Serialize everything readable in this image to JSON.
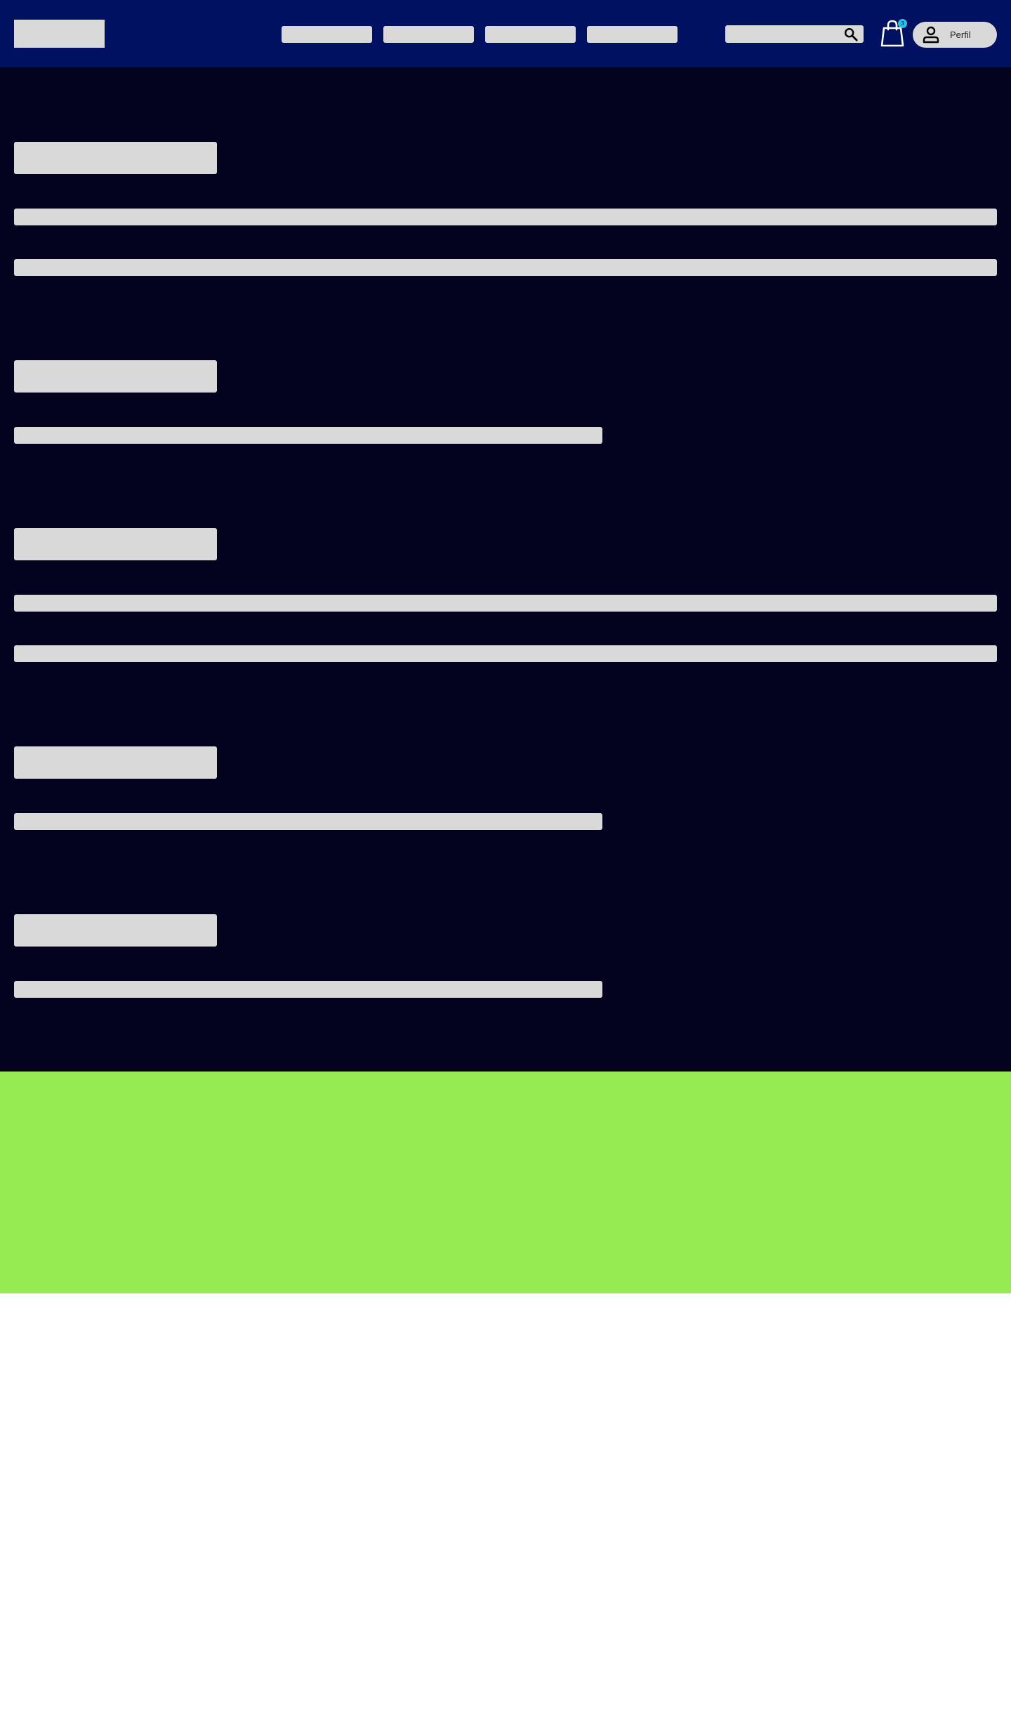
{
  "header": {
    "logo": "",
    "nav_items": [
      "",
      "",
      "",
      ""
    ],
    "search": {
      "placeholder": "",
      "icon": "search-icon"
    },
    "cart": {
      "icon": "shopping-bag-icon",
      "badge_count": "3"
    },
    "profile": {
      "icon": "user-icon",
      "label": "Perfil"
    }
  },
  "colors": {
    "header_bg": "#011161",
    "main_bg": "#04031f",
    "footer_bg": "#96eb52",
    "placeholder": "#d9d9d9",
    "badge": "#27c3e6"
  },
  "main": {
    "sections": [
      {
        "title": "",
        "lines": [
          "",
          ""
        ]
      },
      {
        "title": "",
        "lines": [
          ""
        ]
      },
      {
        "title": "",
        "lines": [
          "",
          ""
        ]
      },
      {
        "title": "",
        "lines": [
          ""
        ]
      },
      {
        "title": "",
        "lines": [
          ""
        ]
      }
    ]
  },
  "footer": {}
}
